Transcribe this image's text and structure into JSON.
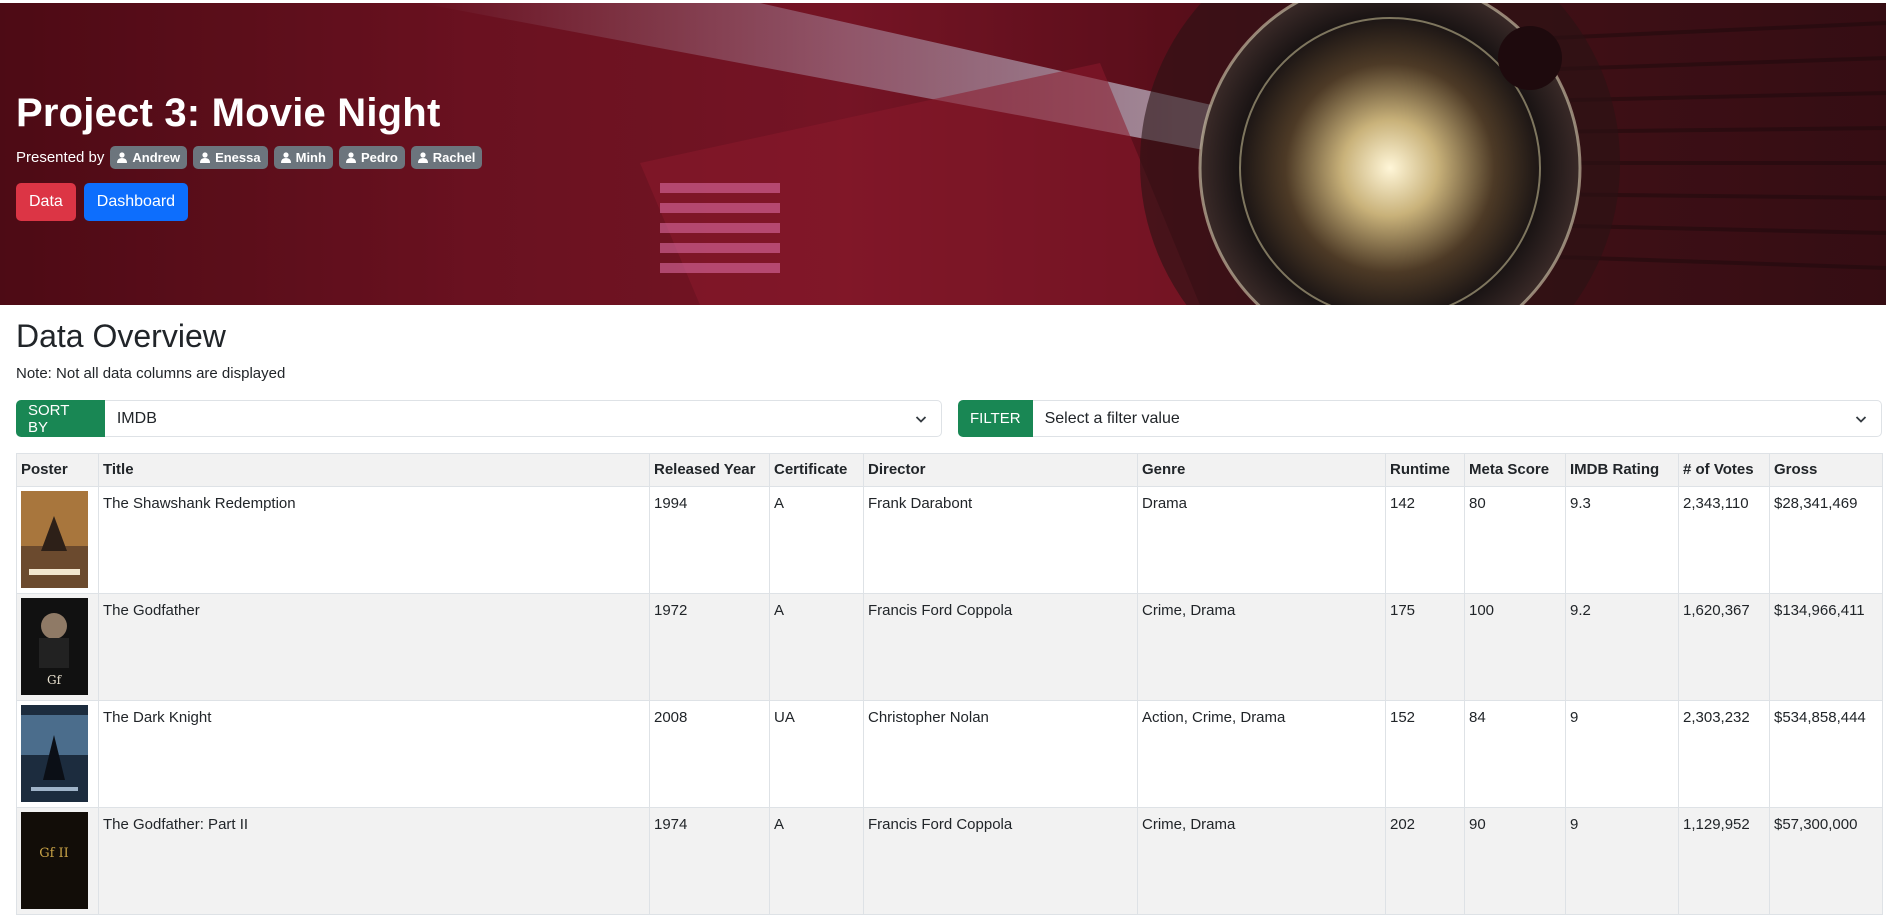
{
  "hero": {
    "title": "Project 3: Movie Night",
    "presented_by": "Presented by",
    "presenters": [
      "Andrew",
      "Enessa",
      "Minh",
      "Pedro",
      "Rachel"
    ],
    "buttons": {
      "data": "Data",
      "dashboard": "Dashboard"
    }
  },
  "overview": {
    "title": "Data Overview",
    "note": "Note: Not all data columns are displayed",
    "sort": {
      "label": "SORT BY",
      "value": "IMDB"
    },
    "filter": {
      "label": "FILTER",
      "placeholder": "Select a filter value"
    }
  },
  "table": {
    "headers": [
      "Poster",
      "Title",
      "Released Year",
      "Certificate",
      "Director",
      "Genre",
      "Runtime",
      "Meta Score",
      "IMDB Rating",
      "# of Votes",
      "Gross"
    ],
    "rows": [
      [
        "The Shawshank Redemption",
        "1994",
        "A",
        "Frank Darabont",
        "Drama",
        "142",
        "80",
        "9.3",
        "2,343,110",
        "$28,341,469"
      ],
      [
        "The Godfather",
        "1972",
        "A",
        "Francis Ford Coppola",
        "Crime, Drama",
        "175",
        "100",
        "9.2",
        "1,620,367",
        "$134,966,411"
      ],
      [
        "The Dark Knight",
        "2008",
        "UA",
        "Christopher Nolan",
        "Action, Crime, Drama",
        "152",
        "84",
        "9",
        "2,303,232",
        "$534,858,444"
      ],
      [
        "The Godfather: Part II",
        "1974",
        "A",
        "Francis Ford Coppola",
        "Crime, Drama",
        "202",
        "90",
        "9",
        "1,129,952",
        "$57,300,000"
      ]
    ]
  },
  "colors": {
    "data_button": "#dc3545",
    "dashboard_button": "#0d6efd",
    "input_label": "#198754",
    "badge": "#6c757d"
  }
}
